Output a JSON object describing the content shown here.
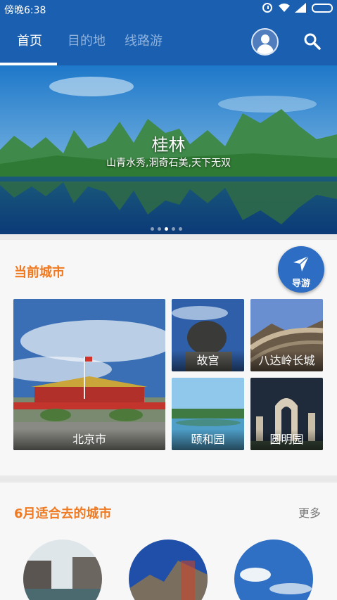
{
  "status_bar": {
    "time": "傍晚6:38"
  },
  "tabs": [
    {
      "label": "首页",
      "active": true
    },
    {
      "label": "目的地",
      "active": false
    },
    {
      "label": "线路游",
      "active": false
    }
  ],
  "banner": {
    "title": "桂林",
    "subtitle": "山青水秀,洞奇石美,天下无双",
    "slide_count": 5,
    "active_slide": 3
  },
  "current_city": {
    "title": "当前城市",
    "guide_label": "导游",
    "main_tile": "北京市",
    "attractions": [
      "故宫",
      "八达岭长城",
      "颐和园",
      "圆明园"
    ]
  },
  "june_cities": {
    "title": "6月适合去的城市",
    "more_label": "更多"
  },
  "colors": {
    "primary": "#1a5fb0",
    "accent": "#ef7a22",
    "guide_button": "#2e6dc4"
  }
}
